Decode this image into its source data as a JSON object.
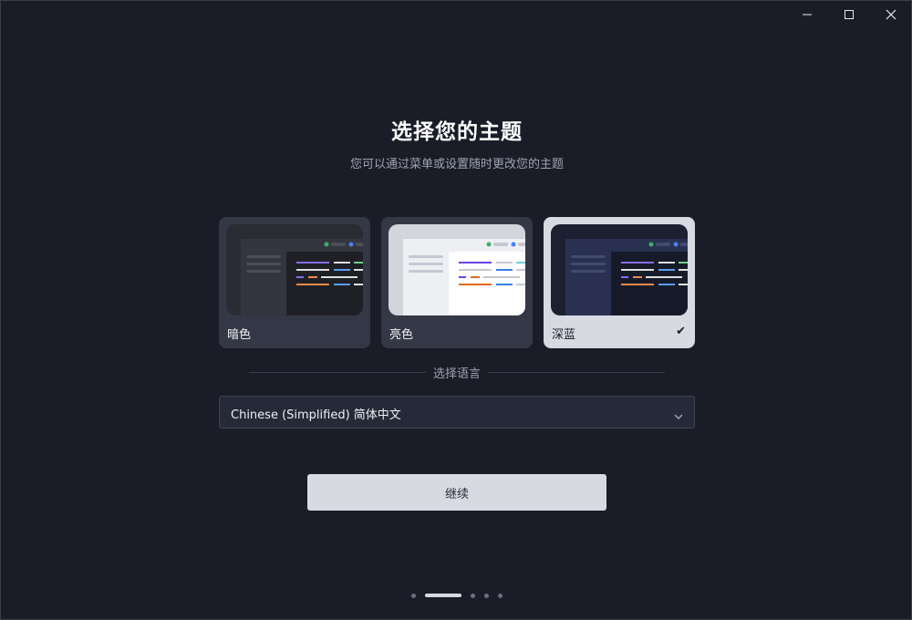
{
  "window_controls": {
    "minimize_icon": "minimize-icon",
    "maximize_icon": "maximize-icon",
    "close_icon": "close-icon"
  },
  "header": {
    "title": "选择您的主题",
    "subtitle": "您可以通过菜单或设置随时更改您的主题"
  },
  "themes": [
    {
      "label": "暗色",
      "selected": false,
      "colors": {
        "outer": "#2a2c33",
        "sidebar": "#33363e",
        "content": "#1f2026"
      }
    },
    {
      "label": "亮色",
      "selected": false,
      "colors": {
        "outer": "#d3d5dc",
        "sidebar": "#eeeff2",
        "content": "#ffffff"
      }
    },
    {
      "label": "深蓝",
      "selected": true,
      "check_icon": "checkmark-icon",
      "check_glyph": "✔",
      "colors": {
        "outer": "#1d2030",
        "sidebar": "#2a3150",
        "content": "#171b29"
      }
    }
  ],
  "language": {
    "divider_label": "选择语言",
    "selected_value": "Chinese (Simplified) 简体中文",
    "chevron_icon": "chevron-down-icon"
  },
  "continue_label": "继续",
  "pagination": {
    "total": 5,
    "active_index": 1
  },
  "colors": {
    "background": "#1a1d27",
    "accent_light": "#d8dae2",
    "card_bg": "#343846"
  }
}
